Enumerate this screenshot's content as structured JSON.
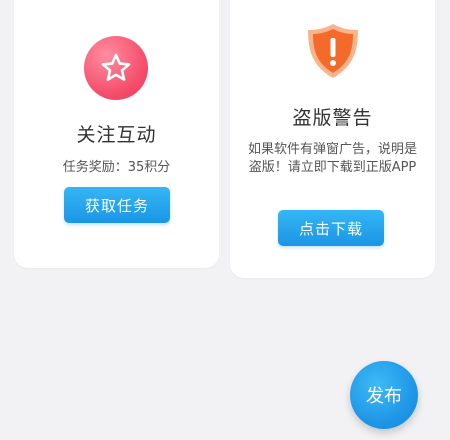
{
  "left_card": {
    "icon": "star-icon",
    "title": "关注互动",
    "reward": "任务奖励：35积分",
    "button": "获取任务"
  },
  "right_card": {
    "icon": "shield-warning-icon",
    "title": "盗版警告",
    "description": "如果软件有弹窗广告，说明是盗版！请立即下载到正版APP",
    "button": "点击下载"
  },
  "fab": {
    "label": "发布"
  },
  "colors": {
    "accent_blue": "#1b95e6",
    "star_red": "#f44d6b",
    "shield_orange": "#f36a2a",
    "background": "#f2f2f5"
  }
}
